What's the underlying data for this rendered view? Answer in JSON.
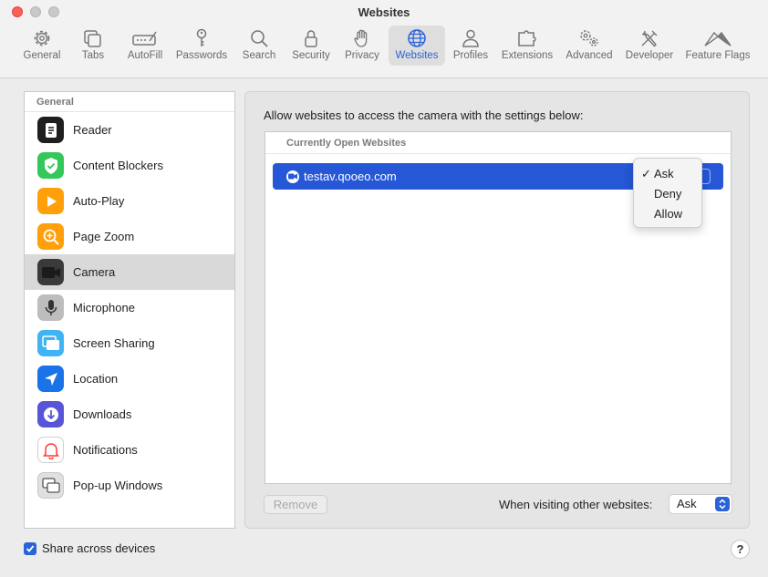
{
  "window": {
    "title": "Websites"
  },
  "toolbar": {
    "items": [
      {
        "label": "General",
        "icon": "gear-icon"
      },
      {
        "label": "Tabs",
        "icon": "tabs-icon"
      },
      {
        "label": "AutoFill",
        "icon": "autofill-icon"
      },
      {
        "label": "Passwords",
        "icon": "key-icon"
      },
      {
        "label": "Search",
        "icon": "search-icon"
      },
      {
        "label": "Security",
        "icon": "lock-icon"
      },
      {
        "label": "Privacy",
        "icon": "hand-icon"
      },
      {
        "label": "Websites",
        "icon": "globe-icon"
      },
      {
        "label": "Profiles",
        "icon": "person-icon"
      },
      {
        "label": "Extensions",
        "icon": "puzzle-icon"
      },
      {
        "label": "Advanced",
        "icon": "gears-icon"
      },
      {
        "label": "Developer",
        "icon": "tools-icon"
      },
      {
        "label": "Feature Flags",
        "icon": "flags-icon"
      }
    ],
    "active": "Websites",
    "accent": "#2a63d8"
  },
  "sidebar": {
    "header": "General",
    "items": [
      {
        "label": "Reader",
        "icon": "reader-icon"
      },
      {
        "label": "Content Blockers",
        "icon": "content-blockers-icon"
      },
      {
        "label": "Auto-Play",
        "icon": "autoplay-icon"
      },
      {
        "label": "Page Zoom",
        "icon": "page-zoom-icon"
      },
      {
        "label": "Camera",
        "icon": "camera-icon"
      },
      {
        "label": "Microphone",
        "icon": "microphone-icon"
      },
      {
        "label": "Screen Sharing",
        "icon": "screen-sharing-icon"
      },
      {
        "label": "Location",
        "icon": "location-icon"
      },
      {
        "label": "Downloads",
        "icon": "downloads-icon"
      },
      {
        "label": "Notifications",
        "icon": "notifications-icon"
      },
      {
        "label": "Pop-up Windows",
        "icon": "popup-windows-icon"
      }
    ],
    "selected": "Camera"
  },
  "main": {
    "description": "Allow websites to access the camera with the settings below:",
    "list_header": "Currently Open Websites",
    "sites": [
      {
        "domain": "testav.qooeo.com",
        "setting": "Ask"
      }
    ],
    "dropdown": {
      "options": [
        "Ask",
        "Deny",
        "Allow"
      ],
      "selected": "Ask"
    },
    "remove_label": "Remove",
    "other_label": "When visiting other websites:",
    "other_value": "Ask"
  },
  "footer": {
    "share_label": "Share across devices",
    "share_checked": true,
    "help_label": "?"
  }
}
